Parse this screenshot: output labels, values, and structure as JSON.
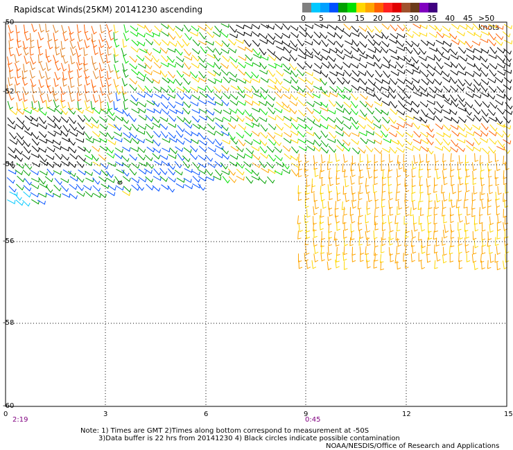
{
  "title": "Rapidscat Winds(25KM) 20141230 ascending",
  "legend": {
    "colors": [
      "#808080",
      "#00c8ff",
      "#00a0ff",
      "#0050ff",
      "#00a000",
      "#00e000",
      "#ffd700",
      "#ffa500",
      "#ff6000",
      "#ff2020",
      "#e00000",
      "#a0522d",
      "#6b3a1a",
      "#8000c0",
      "#400080"
    ],
    "labels": [
      "0",
      "5",
      "10",
      "15",
      "20",
      "25",
      "30",
      "35",
      "40",
      "45"
    ],
    "unit": ">50 knots"
  },
  "lat_labels": [
    "-50",
    "-52",
    "-54",
    "-56",
    "-58",
    "-60"
  ],
  "lon_labels": [
    "0",
    "3",
    "6",
    "9",
    "12",
    "15"
  ],
  "time_labels": [
    "2:19",
    "0:45"
  ],
  "notes": [
    "Note: 1) Times are GMT 2)Times along bottom correspond to measurement at -50S",
    "3)Data buffer is 22 hrs from 20141230 4) Black circles indicate possible contamination",
    "NOAA/NESDIS/Office of Research and Applications"
  ]
}
